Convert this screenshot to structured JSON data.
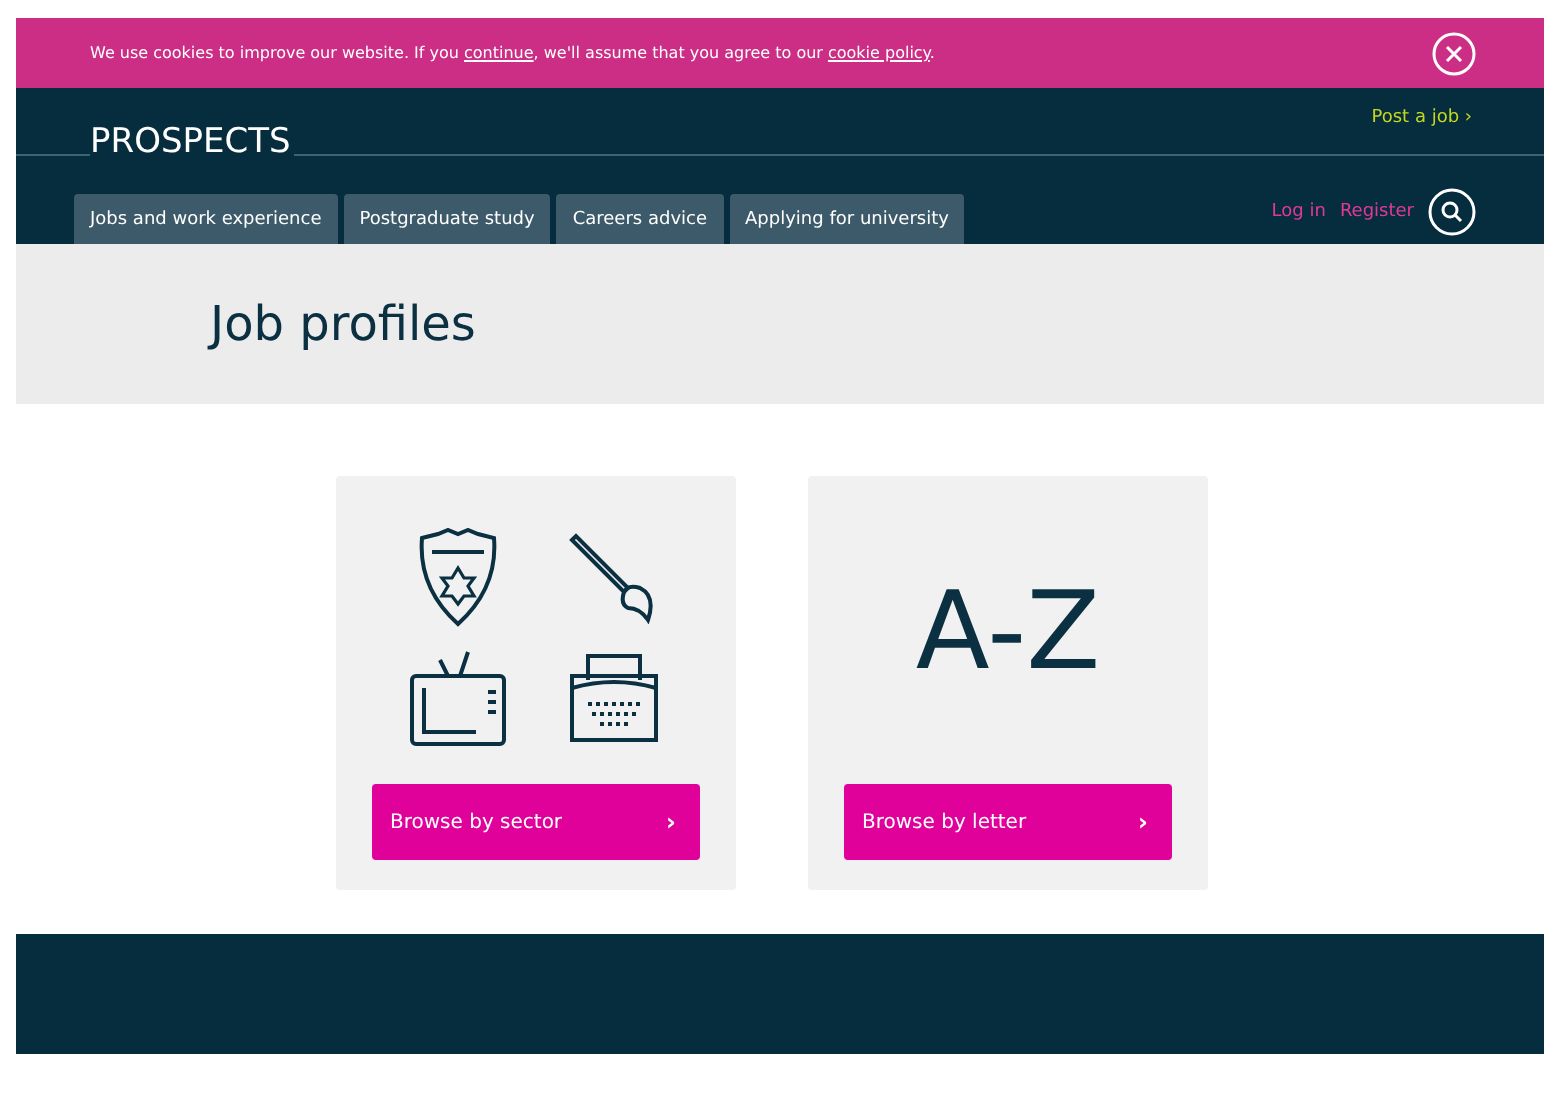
{
  "cookie_banner": {
    "parts": [
      {
        "kind": "text",
        "text": "We use cookies to improve our website. If you "
      },
      {
        "kind": "link",
        "text": "continue"
      },
      {
        "kind": "text",
        "text": ", we'll assume that you agree to our "
      },
      {
        "kind": "link",
        "text": "cookie policy"
      },
      {
        "kind": "text",
        "text": "."
      }
    ]
  },
  "header": {
    "logo": "PROSPECTS",
    "post_link": "Post a job ›",
    "nav_tabs": [
      {
        "label": "Jobs and work experience",
        "selected": false
      },
      {
        "label": "Postgraduate study",
        "selected": false
      },
      {
        "label": "Careers advice",
        "selected": false
      },
      {
        "label": "Applying for university",
        "selected": false
      }
    ],
    "login": "Log in",
    "register": "Register"
  },
  "page_title": "Job profiles",
  "cards": [
    {
      "kind": "icons",
      "button": "Browse by sector",
      "chevron": "›"
    },
    {
      "kind": "letters",
      "letters": "A-Z",
      "button": "Browse by letter",
      "chevron": "›"
    }
  ]
}
